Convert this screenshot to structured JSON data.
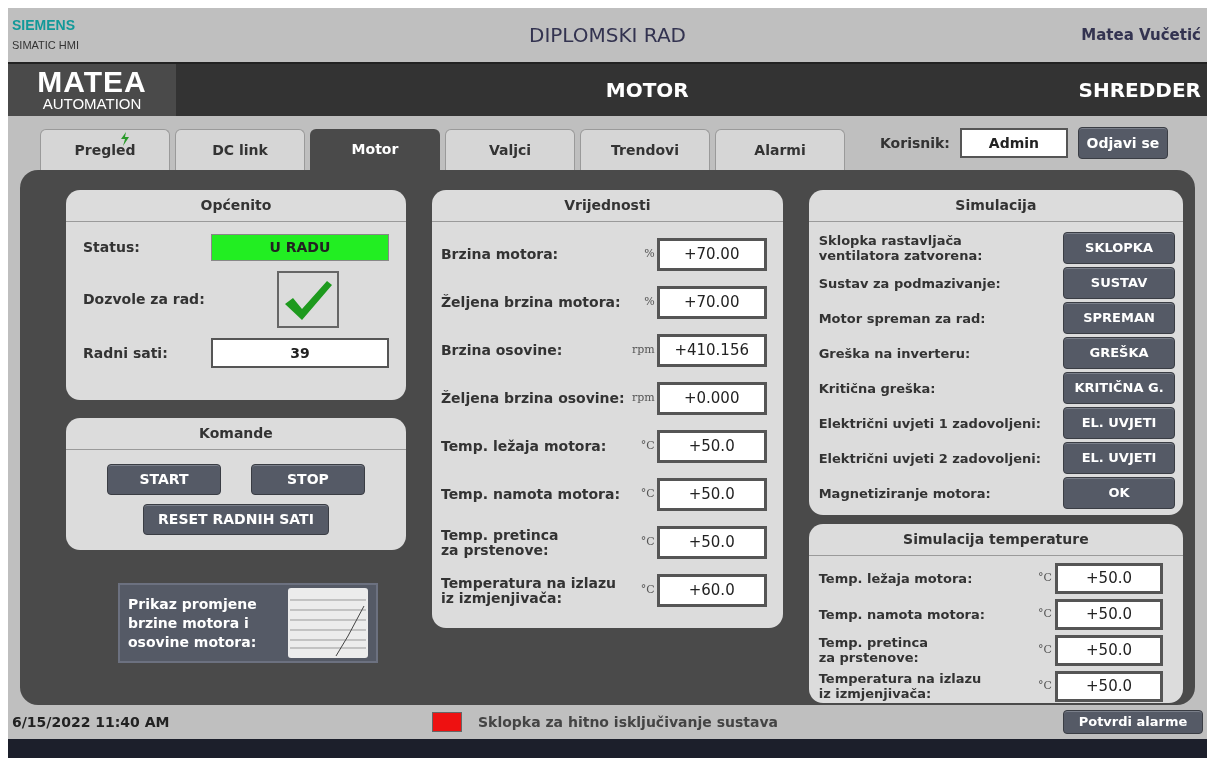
{
  "header": {
    "brand": "SIEMENS",
    "product": "SIMATIC HMI",
    "title": "DIPLOMSKI RAD",
    "author": "Matea Vučetić"
  },
  "banner": {
    "logo": "MATEA",
    "logo_sub": "AUTOMATION",
    "screen": "MOTOR",
    "machine": "SHREDDER"
  },
  "tabs": [
    {
      "label": "Pregled",
      "selected": false
    },
    {
      "label": "DC link",
      "selected": false
    },
    {
      "label": "Motor",
      "selected": true
    },
    {
      "label": "Valjci",
      "selected": false
    },
    {
      "label": "Trendovi",
      "selected": false
    },
    {
      "label": "Alarmi",
      "selected": false
    }
  ],
  "user": {
    "label": "Korisnik:",
    "value": "Admin",
    "logout": "Odjavi se"
  },
  "general": {
    "title": "Općenito",
    "status_label": "Status:",
    "status": {
      "text": "U RADU",
      "color": "#22ee22"
    },
    "permit_label": "Dozvole za rad:",
    "permit_checked": true,
    "hours_label": "Radni sati:",
    "hours": "39"
  },
  "commands": {
    "title": "Komande",
    "buttons": [
      "START",
      "STOP",
      "RESET RADNIH SATI"
    ]
  },
  "trend_button": {
    "label": "Prikaz promjene brzine motora i osovine motora:"
  },
  "values": {
    "title": "Vrijednosti",
    "rows": [
      {
        "label": "Brzina motora:",
        "unit": "%",
        "value": "+70.00"
      },
      {
        "label": "Željena brzina motora:",
        "unit": "%",
        "value": "+70.00"
      },
      {
        "label": "Brzina osovine:",
        "unit": "rpm",
        "value": "+410.156"
      },
      {
        "label": "Željena brzina osovine:",
        "unit": "rpm",
        "value": "+0.000"
      },
      {
        "label": "Temp. ležaja motora:",
        "unit": "°C",
        "value": "+50.0"
      },
      {
        "label": "Temp. namota motora:",
        "unit": "°C",
        "value": "+50.0"
      },
      {
        "label": "Temp. pretinca\nza prstenove:",
        "unit": "°C",
        "value": "+50.0"
      },
      {
        "label": "Temperatura na izlazu\niz izmjenjivača:",
        "unit": "°C",
        "value": "+60.0"
      }
    ]
  },
  "simulation": {
    "title": "Simulacija",
    "rows": [
      {
        "label": "Sklopka rastavljača\nventilatora zatvorena:",
        "button": "SKLOPKA"
      },
      {
        "label": "Sustav za podmazivanje:",
        "button": "SUSTAV"
      },
      {
        "label": "Motor spreman za rad:",
        "button": "SPREMAN"
      },
      {
        "label": "Greška na inverteru:",
        "button": "GREŠKA"
      },
      {
        "label": "Kritična greška:",
        "button": "KRITIČNA G."
      },
      {
        "label": "Električni uvjeti 1 zadovoljeni:",
        "button": "EL. UVJETI"
      },
      {
        "label": "Električni uvjeti 2 zadovoljeni:",
        "button": "EL. UVJETI"
      },
      {
        "label": "Magnetiziranje motora:",
        "button": "OK"
      }
    ]
  },
  "temp_simulation": {
    "title": "Simulacija temperature",
    "rows": [
      {
        "label": "Temp. ležaja motora:",
        "unit": "°C",
        "value": "+50.0"
      },
      {
        "label": "Temp. namota motora:",
        "unit": "°C",
        "value": "+50.0"
      },
      {
        "label": "Temp. pretinca\nza prstenove:",
        "unit": "°C",
        "value": "+50.0"
      },
      {
        "label": "Temperatura na izlazu\niz izmjenjivača:",
        "unit": "°C",
        "value": "+50.0"
      }
    ]
  },
  "status_bar": {
    "datetime": "6/15/2022 11:40 AM",
    "alarm": {
      "color": "#ee1111",
      "text": "Sklopka za hitno isključivanje sustava"
    },
    "ack": "Potvrdi alarme"
  }
}
